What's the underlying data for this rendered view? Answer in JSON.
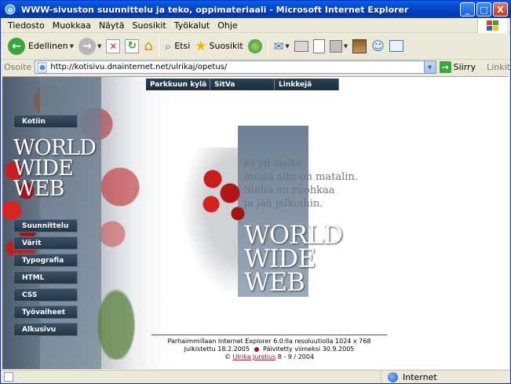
{
  "window": {
    "title": "WWW-sivuston suunnittelu ja teko, oppimateriaali - Microsoft Internet Explorer",
    "controls": {
      "minimize": "_",
      "maximize": "□",
      "close": "X"
    }
  },
  "menubar": {
    "items": [
      "Tiedosto",
      "Muokkaa",
      "Näytä",
      "Suosikit",
      "Työkalut",
      "Ohje"
    ]
  },
  "toolbar": {
    "back_label": "Edellinen",
    "search_label": "Etsi",
    "favorites_label": "Suosikit"
  },
  "addressbar": {
    "label": "Osoite",
    "url": "http://kotisivu.dnainternet.net/ulrikaj/opetus/",
    "go_label": "Siirry",
    "links_label": "Linkit"
  },
  "page": {
    "topnav": [
      "Parkkuun kylä",
      "SitVa",
      "Linkkejä"
    ],
    "home_button": "Kotiin",
    "logo": {
      "line1": "WORLD",
      "line2": "WIDE",
      "line3": "WEB"
    },
    "sidenav": [
      "Suunnittelu",
      "Värit",
      "Typografia",
      "HTML",
      "CSS",
      "Työvaiheet",
      "Alkusivu"
    ],
    "poem": [
      "Ei yli sieltä",
      "missä aita on matalin.",
      "Siellä on ruohkaa",
      "ja jää jalkoihin."
    ],
    "footer": {
      "line1": "Parhaimmillaan Internet Explorer 6.0:lla resoluutiolla 1024 x 768",
      "published": "Julkistettu 18.2.2005",
      "updated": "Päivitetty viimeksi 30.9.2005",
      "copyright_prefix": "©",
      "author": "Ulrika Jurelius",
      "copyright_suffix": "8 - 9 / 2004"
    }
  },
  "statusbar": {
    "status_text": "",
    "zone": "Internet"
  },
  "colors": {
    "titlebar": "#0446c5",
    "nav_button": "#243647",
    "link": "#a0121b"
  }
}
